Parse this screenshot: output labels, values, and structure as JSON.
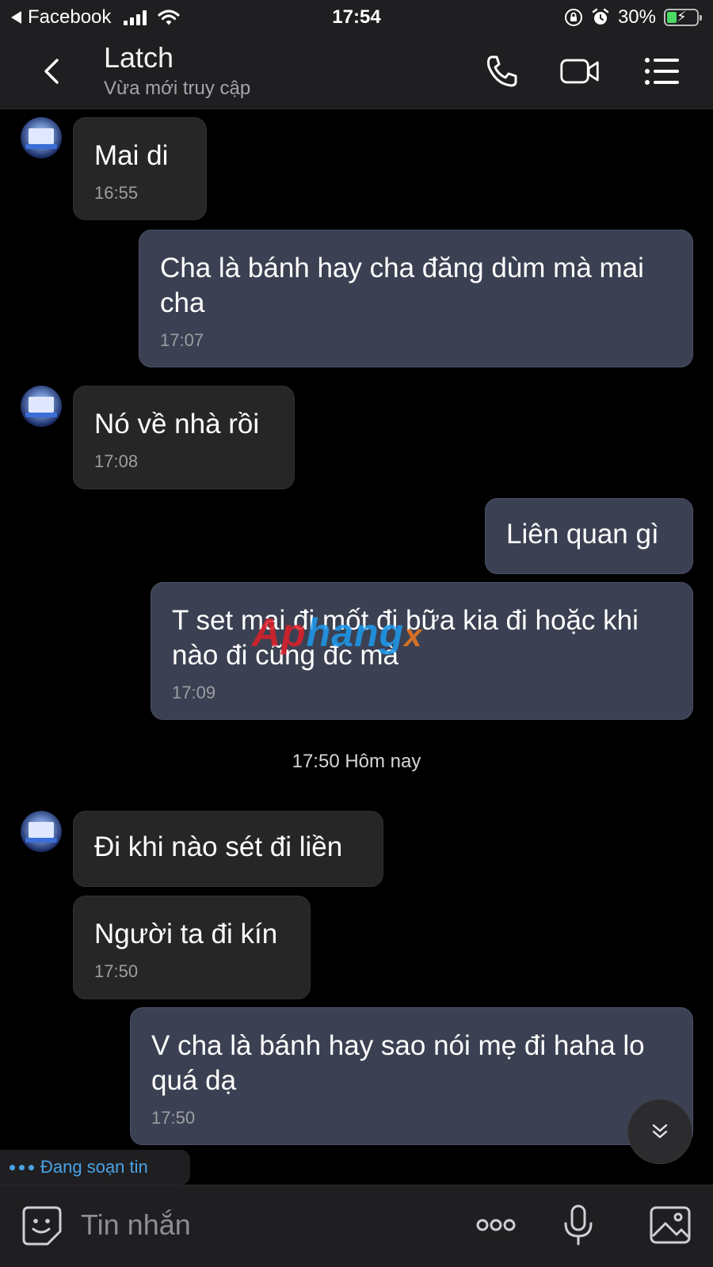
{
  "status_bar": {
    "back_app": "Facebook",
    "time": "17:54",
    "battery": "30%"
  },
  "header": {
    "title": "Latch",
    "subtitle": "Vừa mới truy cập"
  },
  "messages": [
    {
      "side": "in",
      "text": "Mai di",
      "time": "16:55"
    },
    {
      "side": "out",
      "text": "Cha là bánh hay cha đăng dùm mà mai cha",
      "time": "17:07"
    },
    {
      "side": "in",
      "text": "Nó về nhà rồi",
      "time": "17:08"
    },
    {
      "side": "out",
      "text": "Liên quan gì",
      "time": ""
    },
    {
      "side": "out",
      "text": "T set mai đi mốt đi bữa kia đi hoặc khi nào đi cũng đc mà",
      "time": "17:09"
    },
    {
      "side": "in",
      "text": "Đi khi nào sét đi liền",
      "time": ""
    },
    {
      "side": "in",
      "text": "Người ta đi kín",
      "time": "17:50"
    },
    {
      "side": "out",
      "text": "V cha là bánh hay sao nói mẹ đi haha lo quá dạ",
      "time": "17:50"
    }
  ],
  "day_divider": "17:50 Hôm nay",
  "watermark": {
    "part1": "Ap",
    "part2": "hang",
    "part3": "x"
  },
  "typing_indicator": "Đang soạn tin",
  "composer": {
    "placeholder": "Tin nhắn"
  },
  "colors": {
    "incoming_bubble": "#262627",
    "outgoing_bubble": "#3b4152",
    "typing_accent": "#4aa3e6"
  }
}
